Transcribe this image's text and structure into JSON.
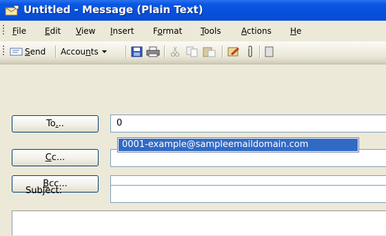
{
  "window": {
    "title": "Untitled - Message (Plain Text)"
  },
  "menu": {
    "items": [
      {
        "label": "File",
        "mnemonic": "F",
        "rest": "ile"
      },
      {
        "label": "Edit",
        "mnemonic": "E",
        "rest": "dit"
      },
      {
        "label": "View",
        "mnemonic": "V",
        "rest": "iew"
      },
      {
        "label": "Insert",
        "mnemonic": "I",
        "rest": "nsert"
      },
      {
        "label": "Format",
        "pre": "F",
        "mnemonic": "o",
        "rest": "rmat"
      },
      {
        "label": "Tools",
        "mnemonic": "T",
        "rest": "ools"
      },
      {
        "label": "Actions",
        "mnemonic": "A",
        "rest": "ctions"
      },
      {
        "label": "He",
        "mnemonic": "H",
        "rest": "e"
      }
    ]
  },
  "toolbar": {
    "send": {
      "mnemonic": "S",
      "rest": "end"
    },
    "accounts": {
      "pre": "Accou",
      "mnemonic": "n",
      "rest": "ts"
    },
    "icons": [
      "save-icon",
      "print-icon",
      "cut-icon",
      "copy-icon",
      "paste-icon",
      "check-names-icon",
      "attach-icon",
      "address-book-icon"
    ]
  },
  "header": {
    "to_button": {
      "pre": "To",
      "mnemonic": "",
      "rest": "..."
    },
    "cc_button": {
      "mnemonic": "C",
      "rest": "c..."
    },
    "bcc_button": {
      "mnemonic": "B",
      "rest": "cc..."
    },
    "subject_label": "Subject:",
    "to_value": "0",
    "cc_value": "",
    "bcc_value": "",
    "subject_value": ""
  },
  "autocomplete": {
    "items": [
      "0001-example@sampleemaildomain.com"
    ],
    "selected_index": 0
  },
  "colors": {
    "titlebar": "#0a57e3",
    "selection": "#316ac5",
    "chrome": "#ece9d8"
  }
}
